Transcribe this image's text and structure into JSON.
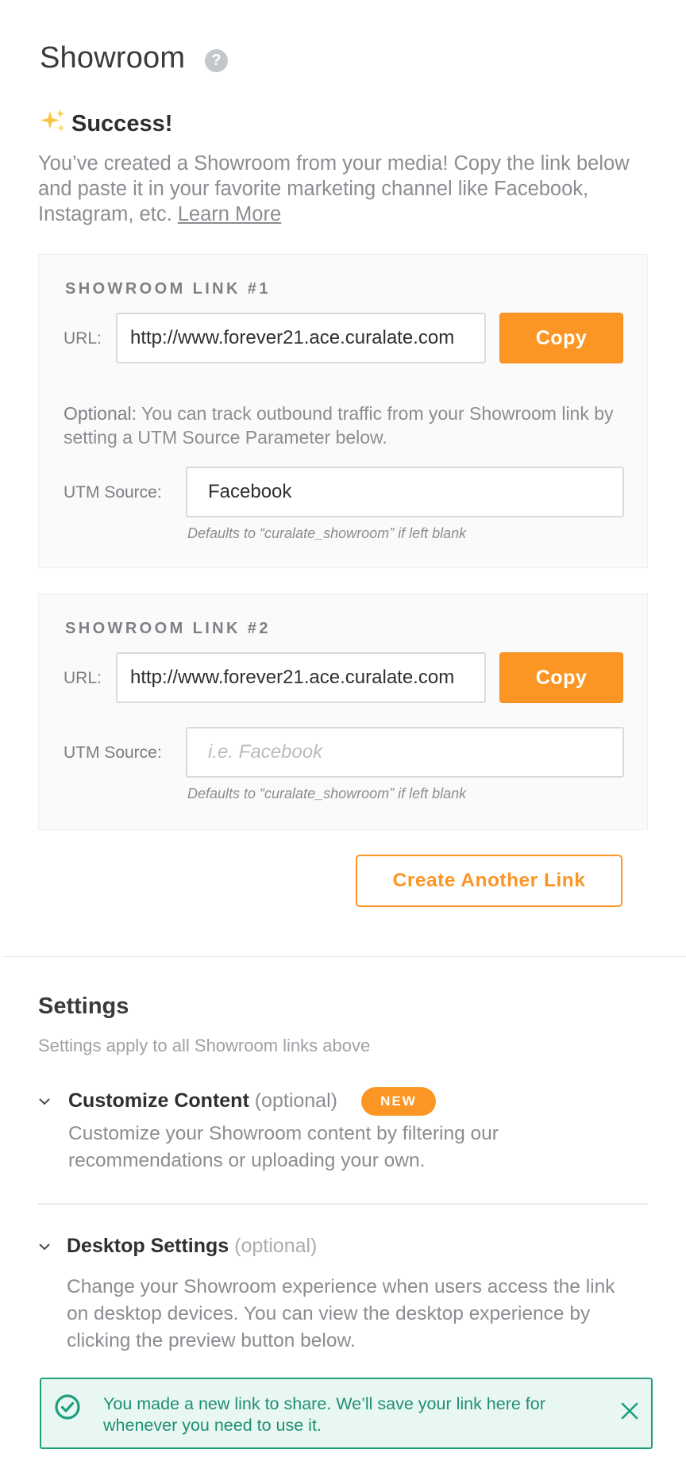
{
  "header": {
    "title": "Showroom",
    "help_icon": "question-circle-icon",
    "help_glyph": "?"
  },
  "success": {
    "icon": "sparkles-icon",
    "title": "Success!",
    "message": "You’ve created a Showroom from your media! Copy the link below and paste it in your favorite marketing channel like Facebook, Instagram, etc.",
    "learn_more": "Learn More"
  },
  "links": [
    {
      "heading": "SHOWROOM LINK #1",
      "url_label": "URL:",
      "url_value": "http://www.forever21.ace.curalate.com",
      "copy_label": "Copy",
      "optional_prefix": "Optional:",
      "optional_text": "You can track outbound traffic from your Showroom link by setting a UTM Source Parameter below.",
      "utm_label": "UTM Source:",
      "utm_value": "Facebook",
      "utm_hint": "Defaults to “curalate_showroom” if left blank"
    },
    {
      "heading": "SHOWROOM LINK #2",
      "url_label": "URL:",
      "url_value": "http://www.forever21.ace.curalate.com",
      "copy_label": "Copy",
      "utm_label": "UTM Source:",
      "utm_placeholder": "i.e. Facebook",
      "utm_hint": "Defaults to “curalate_showroom” if left blank"
    }
  ],
  "create_another_label": "Create Another Link",
  "settings": {
    "title": "Settings",
    "subtitle": "Settings apply to all Showroom links above",
    "sections": [
      {
        "title": "Customize Content",
        "optional": "(optional)",
        "badge": "NEW",
        "description": "Customize your Showroom content by filtering our recommendations or uploading your own."
      },
      {
        "title": "Desktop Settings",
        "optional": "(optional)",
        "description": "Change your Showroom experience when users access the link on desktop devices. You can view the desktop experience by clicking the preview button below."
      }
    ]
  },
  "toast": {
    "icon": "check-circle-icon",
    "message": "You made a new link to share. We’ll save your link here for whenever you need to use it.",
    "close_icon": "close-icon"
  },
  "colors": {
    "accent": "#fb9523",
    "success": "#1f9e7e",
    "success_bg": "#e9f7f3",
    "muted_text": "#8a8d91"
  }
}
